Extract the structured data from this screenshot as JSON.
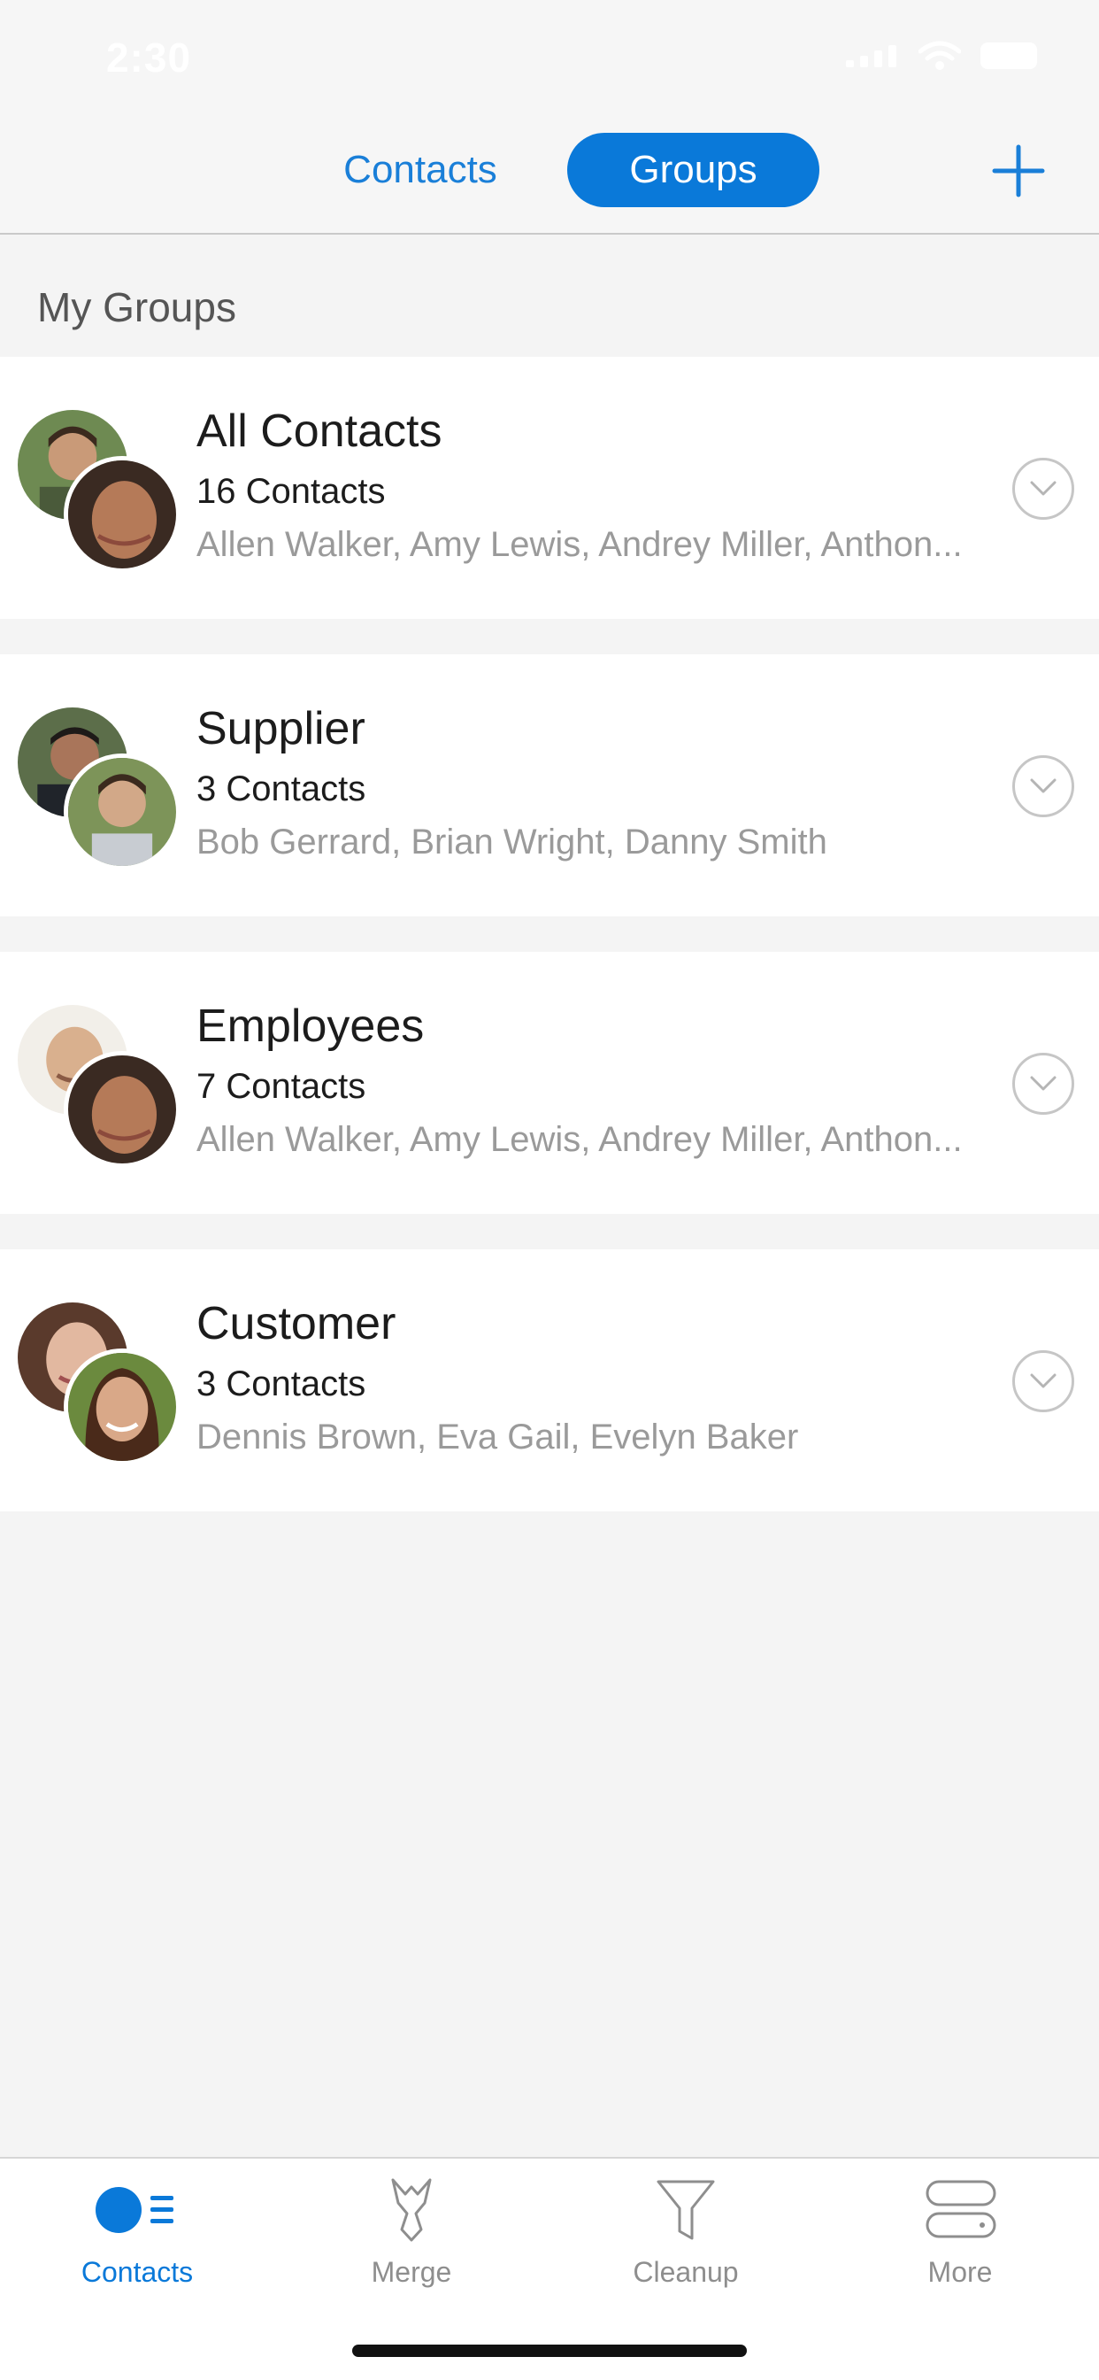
{
  "status_bar": {
    "time": "2:30"
  },
  "nav": {
    "segment_contacts": "Contacts",
    "segment_groups": "Groups",
    "add_icon": "plus-icon"
  },
  "section_title": "My Groups",
  "groups": [
    {
      "name": "All Contacts",
      "count": "16 Contacts",
      "members": "Allen Walker, Amy Lewis, Andrey Miller, Anthon..."
    },
    {
      "name": "Supplier",
      "count": "3 Contacts",
      "members": "Bob Gerrard, Brian Wright, Danny Smith"
    },
    {
      "name": "Employees",
      "count": "7 Contacts",
      "members": "Allen Walker, Amy Lewis, Andrey Miller, Anthon..."
    },
    {
      "name": "Customer",
      "count": "3 Contacts",
      "members": "Dennis Brown, Eva Gail, Evelyn Baker"
    }
  ],
  "tabs": [
    {
      "label": "Contacts",
      "icon": "contacts-icon",
      "active": true
    },
    {
      "label": "Merge",
      "icon": "merge-icon",
      "active": false
    },
    {
      "label": "Cleanup",
      "icon": "filter-icon",
      "active": false
    },
    {
      "label": "More",
      "icon": "more-icon",
      "active": false
    }
  ],
  "colors": {
    "accent": "#0a79d9",
    "background": "#f4f4f4",
    "muted_text": "#9a9a9a"
  }
}
